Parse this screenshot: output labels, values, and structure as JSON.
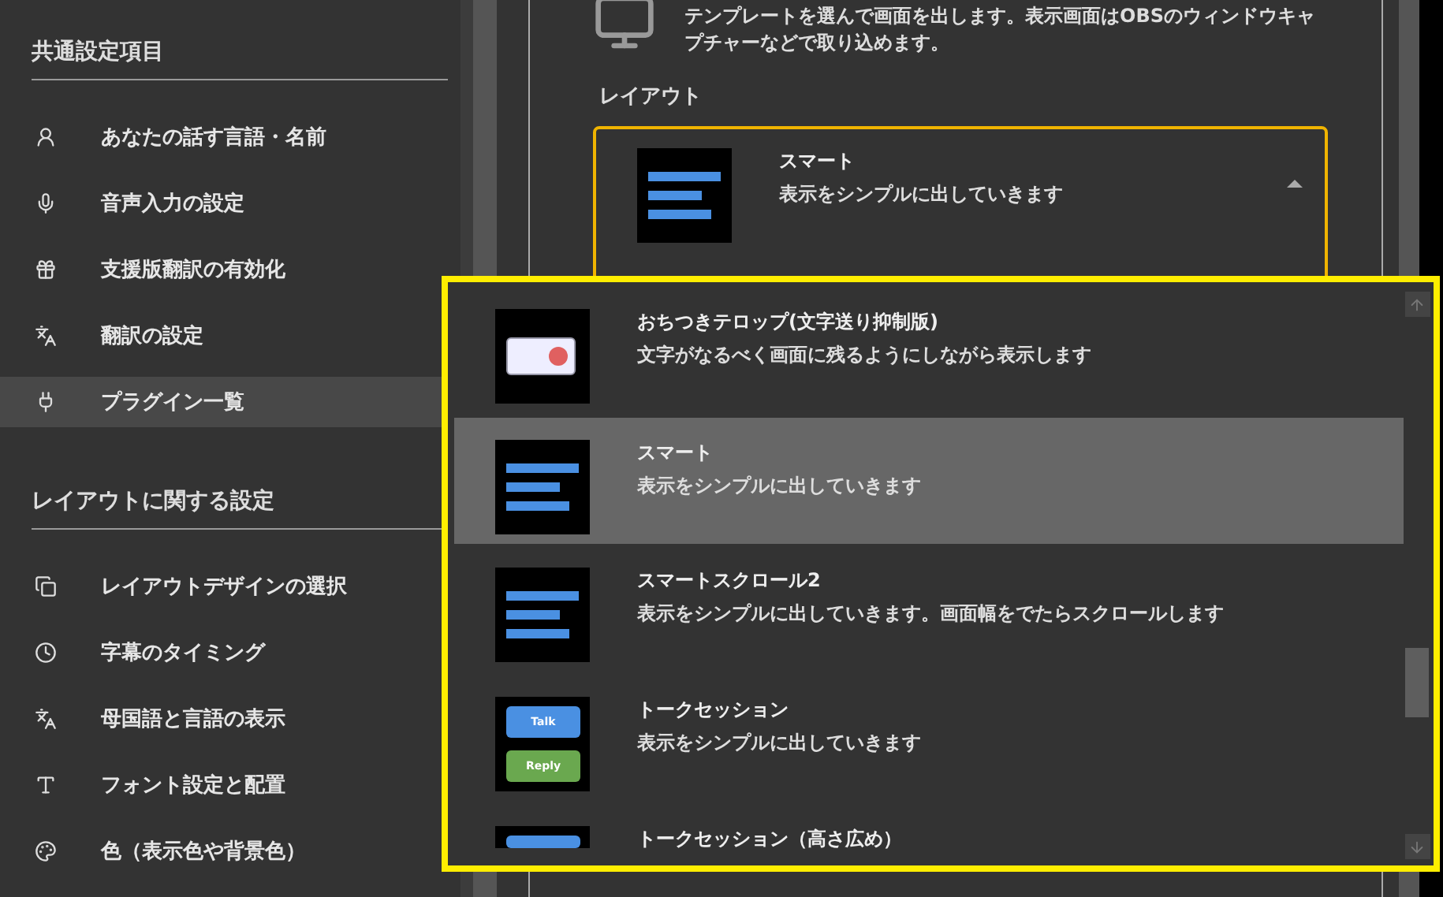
{
  "sidebar": {
    "sections": [
      {
        "title": "共通設定項目",
        "items": [
          {
            "label": "あなたの話す言語・名前",
            "selected": false
          },
          {
            "label": "音声入力の設定",
            "selected": false
          },
          {
            "label": "支援版翻訳の有効化",
            "selected": false
          },
          {
            "label": "翻訳の設定",
            "selected": false
          },
          {
            "label": "プラグイン一覧",
            "selected": true
          }
        ]
      },
      {
        "title": "レイアウトに関する設定",
        "items": [
          {
            "label": "レイアウトデザインの選択",
            "selected": false
          },
          {
            "label": "字幕のタイミング",
            "selected": false
          },
          {
            "label": "母国語と言語の表示",
            "selected": false
          },
          {
            "label": "フォント設定と配置",
            "selected": false
          },
          {
            "label": "色（表示色や背景色）",
            "selected": false
          }
        ]
      }
    ]
  },
  "main": {
    "description": "テンプレートを選んで画面を出します。表示画面はOBSのウィンドウキャプチャーなどで取り込めます。",
    "layout_label": "レイアウト",
    "layout_select": {
      "title": "スマート",
      "description": "表示をシンプルに出していきます",
      "expanded": true
    }
  },
  "dropdown": {
    "options": [
      {
        "kind": "telop",
        "title": "おちつきテロップ(文字送り抑制版)",
        "description": "文字がなるべく画面に残るようにしながら表示します",
        "selected": false
      },
      {
        "kind": "lines",
        "title": "スマート",
        "description": "表示をシンプルに出していきます",
        "selected": true
      },
      {
        "kind": "lines",
        "title": "スマートスクロール2",
        "description": "表示をシンプルに出していきます。画面幅をでたらスクロールします",
        "selected": false
      },
      {
        "kind": "talk",
        "thumb_labels": [
          "Talk",
          "Reply"
        ],
        "title": "トークセッション",
        "description": "表示をシンプルに出していきます",
        "selected": false
      },
      {
        "kind": "partial",
        "title": "トークセッション（高さ広め）",
        "selected": false
      }
    ]
  }
}
